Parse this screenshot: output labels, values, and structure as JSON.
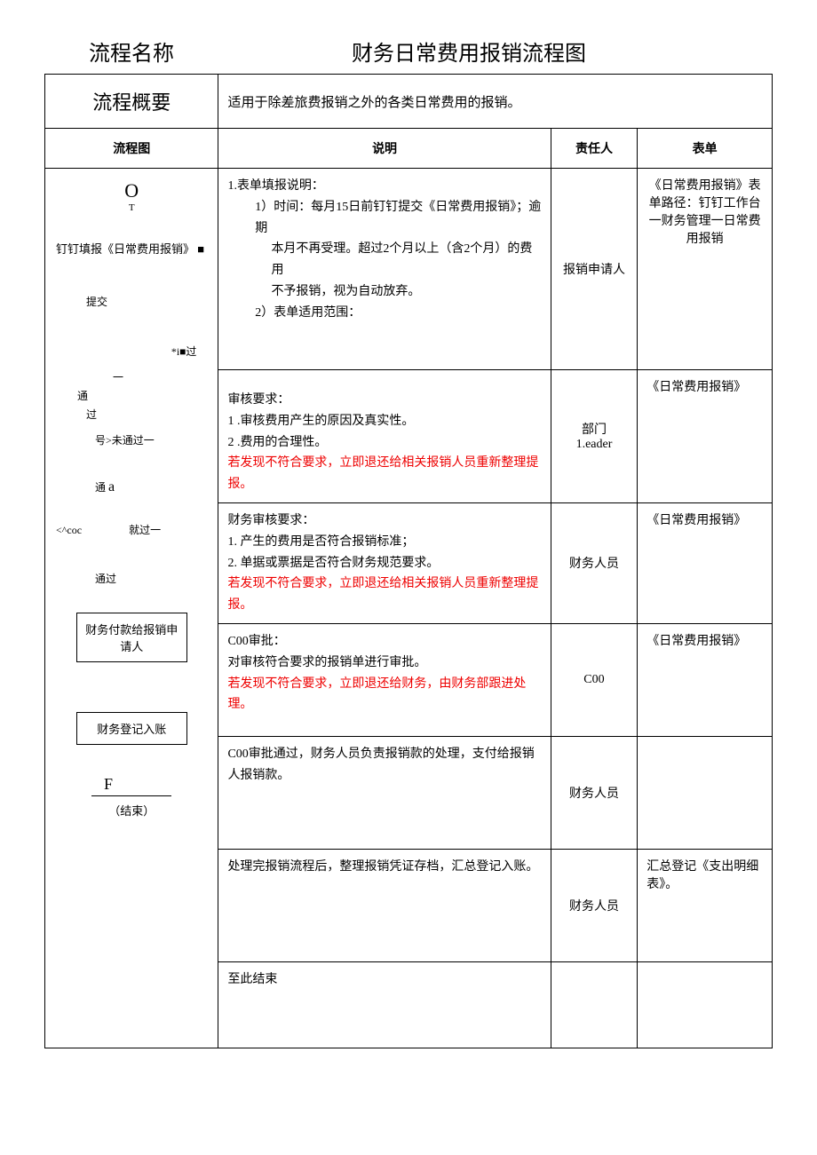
{
  "header": {
    "process_name_label": "流程名称",
    "title": "财务日常费用报销流程图"
  },
  "overview": {
    "label": "流程概要",
    "value": "适用于除差旅费报销之外的各类日常费用的报销。"
  },
  "columns": {
    "flow": "流程图",
    "desc": "说明",
    "resp": "责任人",
    "form": "表单"
  },
  "flow": {
    "start": "O",
    "t_mark": "T",
    "fill_form": "钉钉填报《日常费用报销》",
    "fill_square": "■",
    "submit": "提交",
    "star_i": "*i",
    "sq2": "■",
    "pass_small": "过",
    "dash": "一",
    "pass1": "通",
    "pass1b": "过",
    "not_pass": "号>未通过一",
    "tong_a": "通",
    "a_letter": "a",
    "coc": "<^coc",
    "just_pass": "就过一",
    "pass2": "通过",
    "pay_box": "财务付款给报销申请人",
    "register_box": "财务登记入账",
    "f_mark": "F",
    "end": "（结束）"
  },
  "rows": [
    {
      "desc_lines": [
        {
          "t": "1.表单填报说明：",
          "cls": ""
        },
        {
          "t": "1）时间：每月15日前钉钉提交《日常费用报销》；逾期",
          "cls": "indent1"
        },
        {
          "t": "本月不再受理。超过2个月以上（含2个月）的费用",
          "cls": "indent2"
        },
        {
          "t": "不予报销，视为自动放弃。",
          "cls": "indent2"
        },
        {
          "t": "2）表单适用范围：",
          "cls": "indent1"
        }
      ],
      "resp": "报销申请人",
      "form": "《日常费用报销》表单路径：钉钉工作台一财务管理一日常费用报销"
    },
    {
      "desc_lines": [
        {
          "t": "审核要求：",
          "cls": ""
        },
        {
          "t": "1       .审核费用产生的原因及真实性。",
          "cls": ""
        },
        {
          "t": "2       .费用的合理性。",
          "cls": ""
        },
        {
          "t": "若发现不符合要求，立即退还给相关报销人员重新整理提报。",
          "cls": "red-text"
        }
      ],
      "resp": "部门\n1.eader",
      "form": "《日常费用报销》"
    },
    {
      "desc_lines": [
        {
          "t": "财务审核要求：",
          "cls": ""
        },
        {
          "t": "1.   产生的费用是否符合报销标准；",
          "cls": ""
        },
        {
          "t": "2.   单据或票据是否符合财务规范要求。",
          "cls": ""
        },
        {
          "t": "若发现不符合要求，立即退还给相关报销人员重新整理提报。",
          "cls": "red-text"
        }
      ],
      "resp": "财务人员",
      "form": "《日常费用报销》"
    },
    {
      "desc_lines": [
        {
          "t": "C00审批：",
          "cls": ""
        },
        {
          "t": "对审核符合要求的报销单进行审批。",
          "cls": ""
        },
        {
          "t": "若发现不符合要求，立即退还给财务，由财务部跟进处理。",
          "cls": "red-text"
        }
      ],
      "resp": "C00",
      "form": "《日常费用报销》"
    },
    {
      "desc_lines": [
        {
          "t": "C00审批通过，财务人员负责报销款的处理，支付给报销人报销款。",
          "cls": ""
        }
      ],
      "resp": "财务人员",
      "form": ""
    },
    {
      "desc_lines": [
        {
          "t": "处理完报销流程后，整理报销凭证存档，汇总登记入账。",
          "cls": ""
        }
      ],
      "resp": "财务人员",
      "form": "汇总登记《支出明细表》。"
    },
    {
      "desc_lines": [
        {
          "t": "至此结束",
          "cls": ""
        }
      ],
      "resp": "",
      "form": ""
    }
  ]
}
